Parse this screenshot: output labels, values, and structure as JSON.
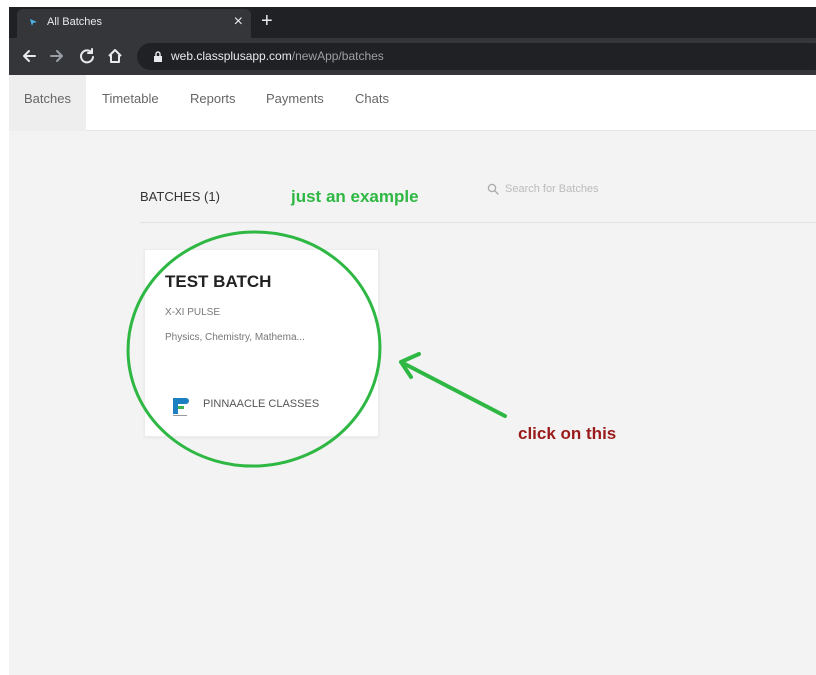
{
  "browser": {
    "tab_title": "All Batches",
    "tab_close": "×",
    "new_tab": "+",
    "url_host": "web.classplusapp.com",
    "url_path": "/newApp/batches"
  },
  "nav": {
    "batches": "Batches",
    "timetable": "Timetable",
    "reports": "Reports",
    "payments": "Payments",
    "chats": "Chats"
  },
  "main": {
    "heading": "BATCHES (1)",
    "search_placeholder": "Search for Batches"
  },
  "batch_card": {
    "title": "TEST BATCH",
    "course": "X-XI PULSE",
    "subjects": "Physics, Chemistry, Mathema...",
    "org_name": "PINNAACLE CLASSES"
  },
  "annotations": {
    "example_note": "just an example",
    "click_note": "click on this",
    "circle_color": "#2eb843",
    "arrow_color": "#2eb843"
  },
  "colors": {
    "chrome_dark": "#202124",
    "chrome_tab": "#35363a",
    "accent_green": "#2eb843",
    "note_red": "#9a1b1b"
  },
  "icons": {
    "favicon": "classplus-favicon",
    "back": "arrow-left-icon",
    "forward": "arrow-right-icon",
    "reload": "reload-icon",
    "home": "home-icon",
    "lock": "lock-icon",
    "search": "search-icon",
    "logo": "pinnaacle-logo"
  }
}
